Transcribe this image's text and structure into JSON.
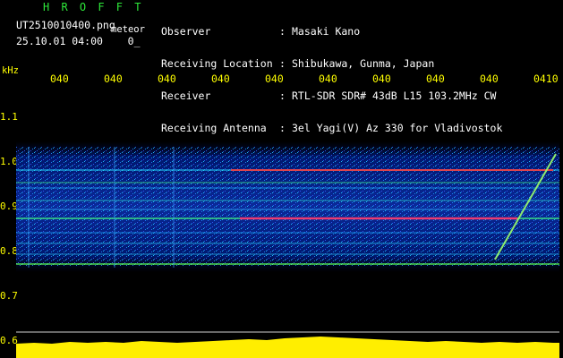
{
  "header": {
    "brand": "H R O F F T",
    "filename": "UT2510010400.png",
    "meteor_label": "meteor",
    "datetime": "25.10.01 04:00",
    "counter": "0_"
  },
  "info": {
    "labels": [
      "Observer",
      "Receiving Location",
      "Receiver",
      "Receiving Antenna"
    ],
    "colon": ":",
    "values": [
      "Masaki Kano",
      "Shibukawa, Gunma, Japan",
      "RTL-SDR SDR# 43dB L15 103.2MHz CW",
      "3el Yagi(V) Az 330 for Vladivostok"
    ]
  },
  "axes": {
    "y_unit": "kHz",
    "y_ticks": [
      "1.1",
      "1.0",
      "0.9",
      "0.8",
      "0.7",
      "0.6"
    ],
    "x_ticks": [
      "040",
      "040",
      "040",
      "040",
      "040",
      "040",
      "040",
      "040",
      "040",
      "0410"
    ]
  },
  "colors": {
    "text_white": "#ffffff",
    "text_green": "#2ee83a",
    "tick_yellow": "#ffff00",
    "background": "#000000"
  }
}
